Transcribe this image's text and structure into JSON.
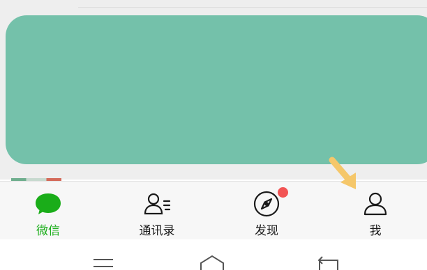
{
  "tabs": [
    {
      "label": "微信",
      "icon": "chat-bubble-icon",
      "active": true
    },
    {
      "label": "通讯录",
      "icon": "contacts-icon",
      "active": false
    },
    {
      "label": "发现",
      "icon": "compass-icon",
      "active": false,
      "badge": true
    },
    {
      "label": "我",
      "icon": "person-icon",
      "active": false
    }
  ],
  "colors": {
    "accent": "#1aad19",
    "content_card": "#74c1aa",
    "badge": "#f25454",
    "arrow": "#f5c76a"
  },
  "system_nav": [
    "menu-icon",
    "home-icon",
    "back-icon"
  ]
}
